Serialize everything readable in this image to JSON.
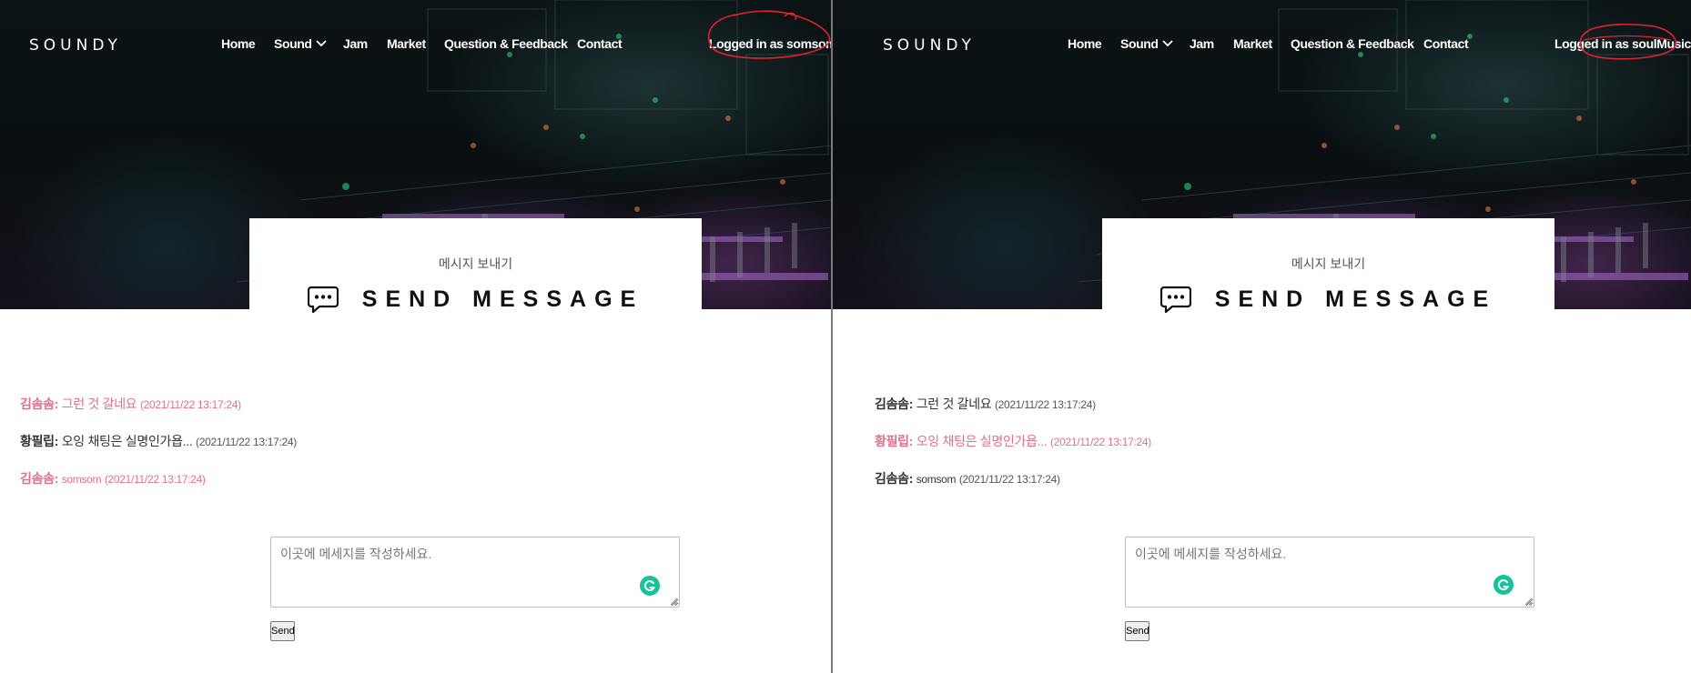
{
  "left": {
    "brand": "SOUNDY",
    "nav": {
      "home": "Home",
      "sound": "Sound",
      "jam": "Jam",
      "market": "Market",
      "qa": "Question & Feedback",
      "contact": "Contact"
    },
    "login_status": "Logged in as somsom",
    "card": {
      "subtitle": "메시지 보내기",
      "title": "SEND MESSAGE"
    },
    "messages": [
      {
        "sender": "김솜솜:",
        "text": "그런 것 갈네요",
        "time": "(2021/11/22 13:17:24)"
      },
      {
        "sender": "황필립:",
        "text": "오잉 채팅은 실명인가욥...",
        "time": "(2021/11/22 13:17:24)"
      },
      {
        "sender": "김솜솜:",
        "text": "somsom",
        "time": "(2021/11/22 13:17:24)"
      }
    ],
    "composer_placeholder": "이곳에 메세지를 작성하세요.",
    "send_label": "Send"
  },
  "right": {
    "brand": "SOUNDY",
    "nav": {
      "home": "Home",
      "sound": "Sound",
      "jam": "Jam",
      "market": "Market",
      "qa": "Question & Feedback",
      "contact": "Contact"
    },
    "login_status": "Logged in as soulMusic",
    "card": {
      "subtitle": "메시지 보내기",
      "title": "SEND MESSAGE"
    },
    "messages": [
      {
        "sender": "김솜솜:",
        "text": "그런 것 갈네요",
        "time": "(2021/11/22 13:17:24)"
      },
      {
        "sender": "황필립:",
        "text": "오잉 채팅은 실명인가욥...",
        "time": "(2021/11/22 13:17:24)"
      },
      {
        "sender": "김솜솜:",
        "text": "somsom",
        "time": "(2021/11/22 13:17:24)"
      }
    ],
    "composer_placeholder": "이곳에 메세지를 작성하세요.",
    "send_label": "Send"
  },
  "colors": {
    "own_message": "#e2708a",
    "other_message": "#333333",
    "annotation": "#e0242a",
    "grammarly": "#15c39a"
  },
  "icons": [
    "chevron-down-icon",
    "chat-bubble-icon",
    "grammarly-icon",
    "resize-grip-icon"
  ]
}
